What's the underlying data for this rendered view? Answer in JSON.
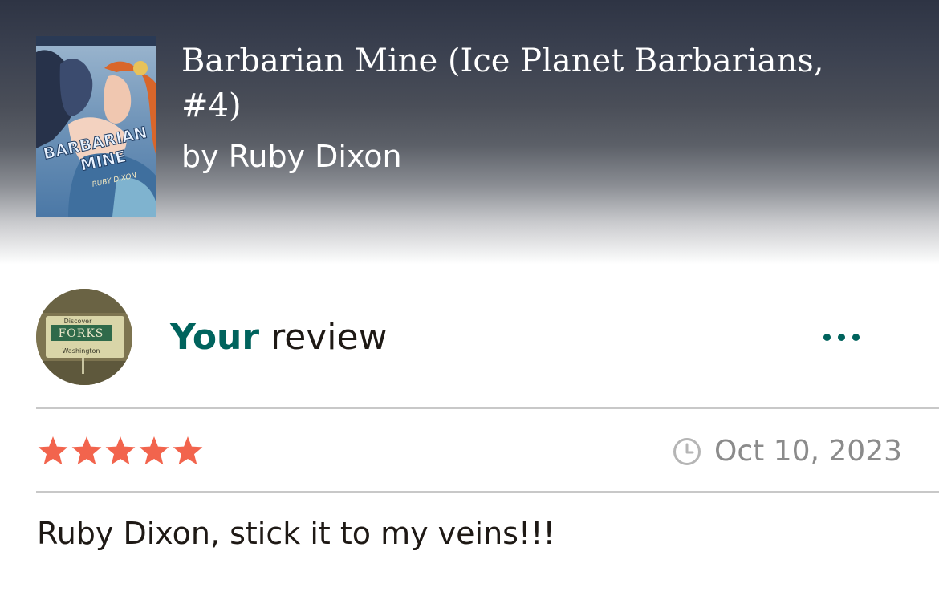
{
  "book": {
    "title": "Barbarian Mine (Ice Planet Barbarians, #4)",
    "author_line": "by Ruby Dixon",
    "cover": {
      "title_text": "BARBARIAN MINE",
      "author_text": "RUBY DIXON"
    }
  },
  "avatar": {
    "sign_top": "Discover",
    "sign_main": "FORKS",
    "sign_bottom": "Washington"
  },
  "review": {
    "heading_owner": "Your",
    "heading_rest": " review",
    "more_icon": "more-horizontal-icon",
    "rating": 5,
    "rating_max": 5,
    "date_icon": "clock-icon",
    "date": "Oct 10, 2023",
    "text": "Ruby Dixon, stick it to my veins!!!"
  },
  "colors": {
    "accent": "#00635d",
    "star": "#f2644d",
    "muted": "#8b8b8b",
    "text": "#1e1915",
    "divider": "#c8c8c8"
  }
}
